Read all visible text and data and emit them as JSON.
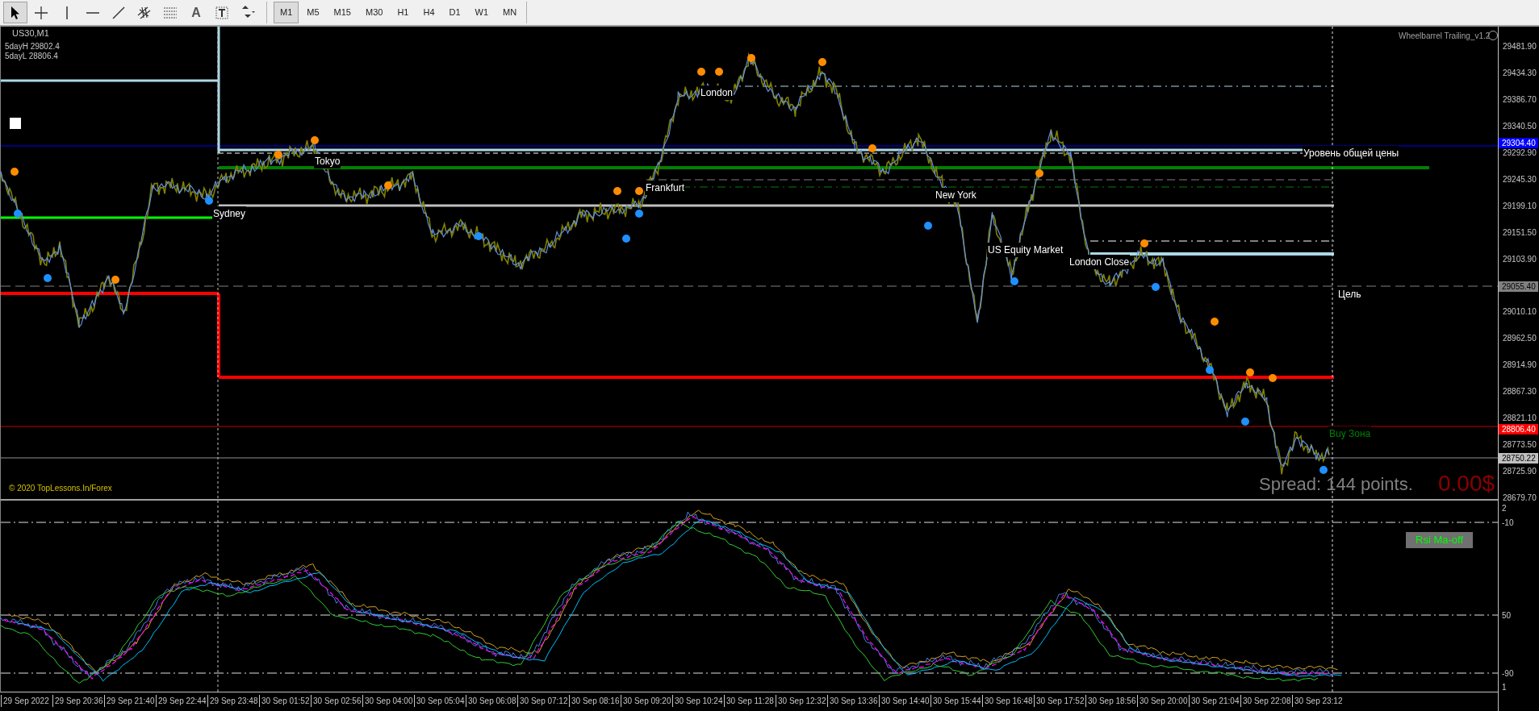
{
  "toolbar": {
    "tools": [
      {
        "kind": "cursor",
        "selected": true
      },
      {
        "kind": "crosshair",
        "selected": false
      },
      {
        "kind": "vertical-line",
        "selected": false
      },
      {
        "kind": "horizontal-line",
        "selected": false
      },
      {
        "kind": "trend-line",
        "selected": false
      },
      {
        "kind": "channel",
        "selected": false
      },
      {
        "kind": "levels",
        "selected": false
      },
      {
        "kind": "text",
        "glyph": "A",
        "selected": false
      },
      {
        "kind": "label",
        "selected": false
      },
      {
        "kind": "arrows",
        "selected": false
      }
    ],
    "timeframes": [
      {
        "label": "M1",
        "selected": true
      },
      {
        "label": "M5",
        "selected": false
      },
      {
        "label": "M15",
        "selected": false
      },
      {
        "label": "M30",
        "selected": false
      },
      {
        "label": "H1",
        "selected": false
      },
      {
        "label": "H4",
        "selected": false
      },
      {
        "label": "D1",
        "selected": false
      },
      {
        "label": "W1",
        "selected": false
      },
      {
        "label": "MN",
        "selected": false
      }
    ]
  },
  "chart": {
    "symbol": "US30,M1",
    "checkbox": {
      "checked": false
    },
    "info": [
      "5dayH 29802.4",
      "5dayL 28806.4"
    ],
    "expert": "Wheelbarrel Trailing_v1.2",
    "labels": [
      {
        "kind": "session",
        "text": "Sydney"
      },
      {
        "kind": "session",
        "text": "Tokyo"
      },
      {
        "kind": "session",
        "text": "Frankfurt"
      },
      {
        "kind": "session",
        "text": "London"
      },
      {
        "kind": "session",
        "text": "New York"
      },
      {
        "kind": "session",
        "text": "US Equity Market"
      },
      {
        "kind": "session",
        "text": "London Close"
      },
      {
        "kind": "level",
        "text": "Уровень общей цены"
      },
      {
        "kind": "level",
        "text": "Цель"
      },
      {
        "kind": "zone",
        "text": "Buy Зона"
      }
    ],
    "spread": "Spread: 144 points.",
    "profit": "0.00$",
    "copyright": "© 2020 TopLessons.In/Forex"
  },
  "price_axis": {
    "ticks": [
      "29481.90",
      "29434.30",
      "29386.70",
      "29340.50",
      "29292.90",
      "29245.30",
      "29199.10",
      "29151.50",
      "29103.90",
      "29010.10",
      "28962.50",
      "28914.90",
      "28867.30",
      "28821.10",
      "28773.50",
      "28725.90",
      "28679.70"
    ],
    "markers": [
      {
        "text": "29304.40",
        "color": "#0000ff"
      },
      {
        "text": "29055.40",
        "color": "#808080"
      },
      {
        "text": "28806.40",
        "color": "#ff0000"
      },
      {
        "text": "28750.22",
        "color": "#c0c0c0"
      }
    ]
  },
  "indicator": {
    "button": "Rsi Ma-off",
    "axis": [
      "2",
      "-10",
      "50",
      "-90",
      "1"
    ]
  },
  "time_axis": [
    "29 Sep 2022",
    "29 Sep 20:36",
    "29 Sep 21:40",
    "29 Sep 22:44",
    "29 Sep 23:48",
    "30 Sep 01:52",
    "30 Sep 02:56",
    "30 Sep 04:00",
    "30 Sep 05:04",
    "30 Sep 06:08",
    "30 Sep 07:12",
    "30 Sep 08:16",
    "30 Sep 09:20",
    "30 Sep 10:24",
    "30 Sep 11:28",
    "30 Sep 12:32",
    "30 Sep 13:36",
    "30 Sep 14:40",
    "30 Sep 15:44",
    "30 Sep 16:48",
    "30 Sep 17:52",
    "30 Sep 18:56",
    "30 Sep 20:00",
    "30 Sep 21:04",
    "30 Sep 22:08",
    "30 Sep 23:12"
  ]
}
